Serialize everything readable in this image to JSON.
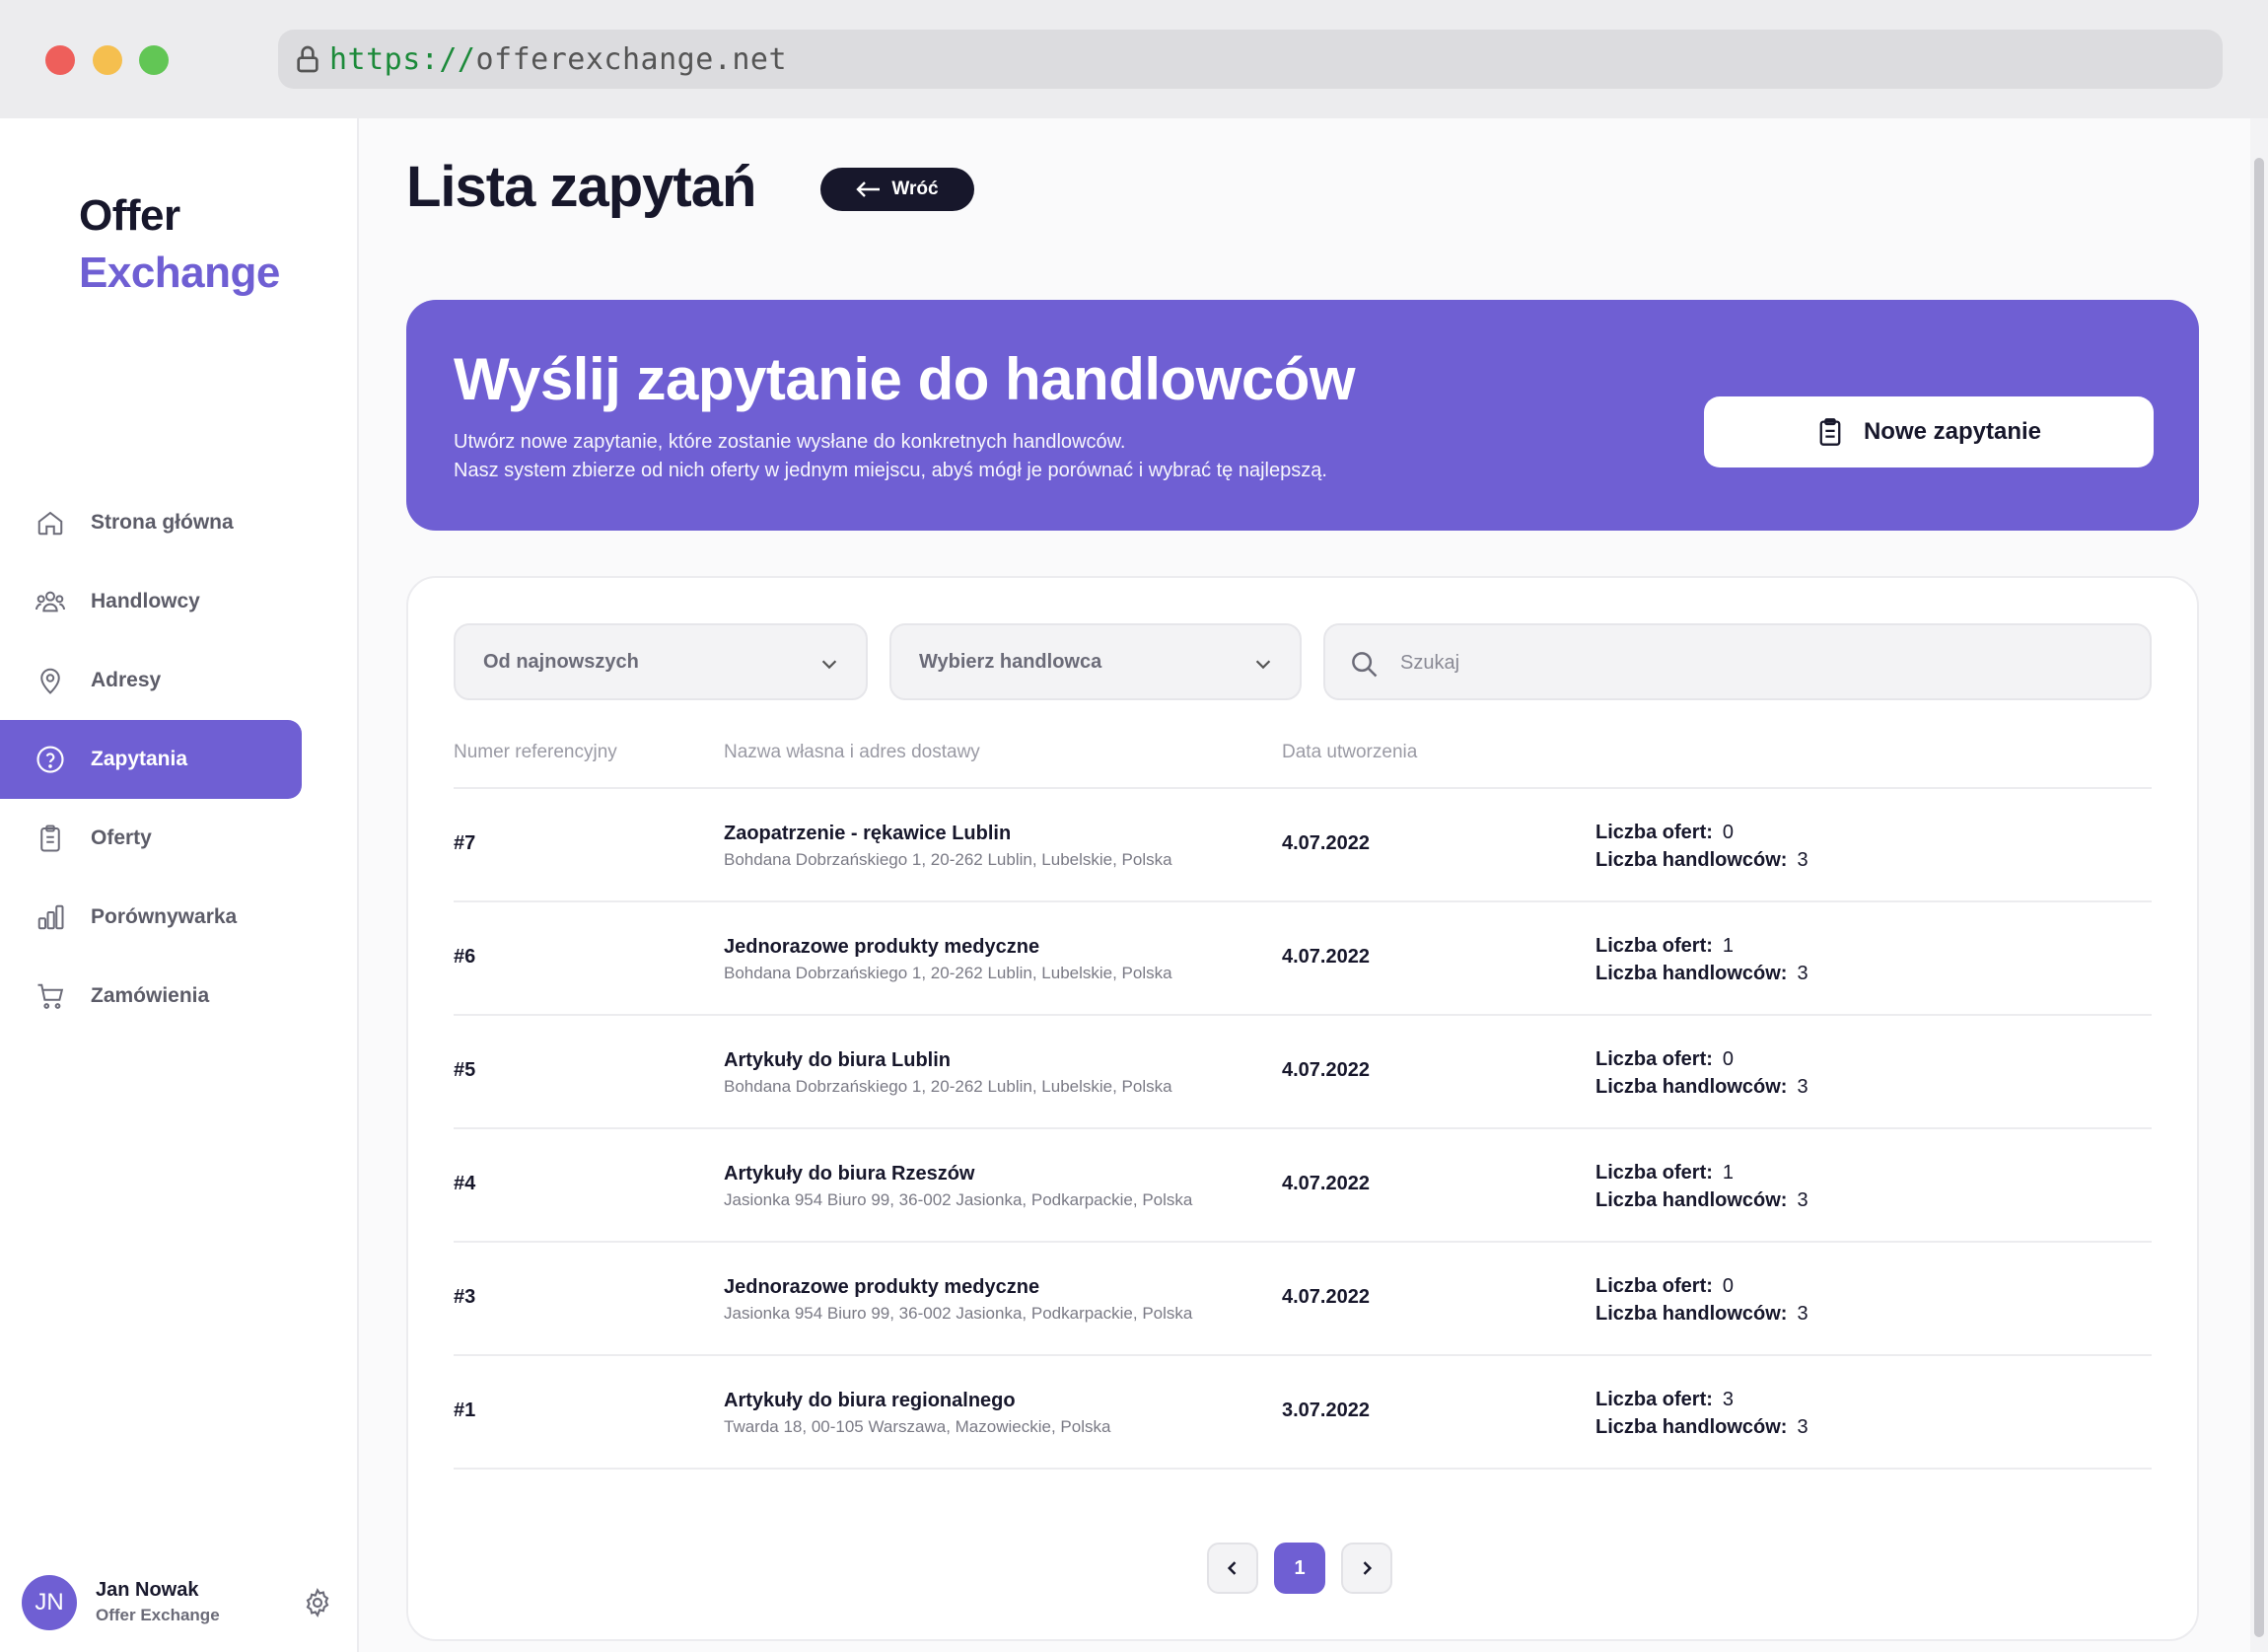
{
  "browser": {
    "url_protocol": "https://",
    "url_host": "offerexchange.net"
  },
  "sidebar": {
    "logo_line1": "Offer",
    "logo_line2": "Exchange",
    "items": [
      {
        "label": "Strona główna",
        "icon": "home-icon"
      },
      {
        "label": "Handlowcy",
        "icon": "users-icon"
      },
      {
        "label": "Adresy",
        "icon": "map-pin-icon"
      },
      {
        "label": "Zapytania",
        "icon": "question-circle-icon",
        "active": true
      },
      {
        "label": "Oferty",
        "icon": "clipboard-icon"
      },
      {
        "label": "Porównywarka",
        "icon": "bar-chart-icon"
      },
      {
        "label": "Zamówienia",
        "icon": "cart-icon"
      }
    ],
    "user": {
      "initials": "JN",
      "name": "Jan Nowak",
      "org": "Offer Exchange"
    }
  },
  "header": {
    "title": "Lista zapytań",
    "back_label": "Wróć"
  },
  "banner": {
    "heading": "Wyślij zapytanie do handlowców",
    "desc_line1": "Utwórz nowe zapytanie, które zostanie wysłane do konkretnych handlowców.",
    "desc_line2": "Nasz system zbierze od nich oferty w jednym miejscu, abyś mógł je porównać i wybrać tę najlepszą.",
    "button_label": "Nowe zapytanie"
  },
  "filters": {
    "sort_value": "Od najnowszych",
    "dealer_value": "Wybierz handlowca",
    "search_placeholder": "Szukaj"
  },
  "table": {
    "columns": [
      "Numer referencyjny",
      "Nazwa własna i adres dostawy",
      "Data utworzenia"
    ],
    "offers_label": "Liczba ofert:",
    "dealers_label": "Liczba handlowców:",
    "rows": [
      {
        "ref": "#7",
        "name": "Zaopatrzenie - rękawice Lublin",
        "address": "Bohdana Dobrzańskiego 1, 20-262 Lublin, Lubelskie, Polska",
        "date": "4.07.2022",
        "offers": "0",
        "dealers": "3"
      },
      {
        "ref": "#6",
        "name": "Jednorazowe produkty medyczne",
        "address": "Bohdana Dobrzańskiego 1, 20-262 Lublin, Lubelskie, Polska",
        "date": "4.07.2022",
        "offers": "1",
        "dealers": "3"
      },
      {
        "ref": "#5",
        "name": "Artykuły do biura Lublin",
        "address": "Bohdana Dobrzańskiego 1, 20-262 Lublin, Lubelskie, Polska",
        "date": "4.07.2022",
        "offers": "0",
        "dealers": "3"
      },
      {
        "ref": "#4",
        "name": "Artykuły do biura Rzeszów",
        "address": "Jasionka 954 Biuro 99, 36-002 Jasionka, Podkarpackie, Polska",
        "date": "4.07.2022",
        "offers": "1",
        "dealers": "3"
      },
      {
        "ref": "#3",
        "name": "Jednorazowe produkty medyczne",
        "address": "Jasionka 954 Biuro 99, 36-002 Jasionka, Podkarpackie, Polska",
        "date": "4.07.2022",
        "offers": "0",
        "dealers": "3"
      },
      {
        "ref": "#1",
        "name": "Artykuły do biura regionalnego",
        "address": "Twarda 18, 00-105 Warszawa, Mazowieckie, Polska",
        "date": "3.07.2022",
        "offers": "3",
        "dealers": "3"
      }
    ]
  },
  "pagination": {
    "current": "1"
  },
  "colors": {
    "accent": "#6f5fd3",
    "dark": "#17172b"
  }
}
